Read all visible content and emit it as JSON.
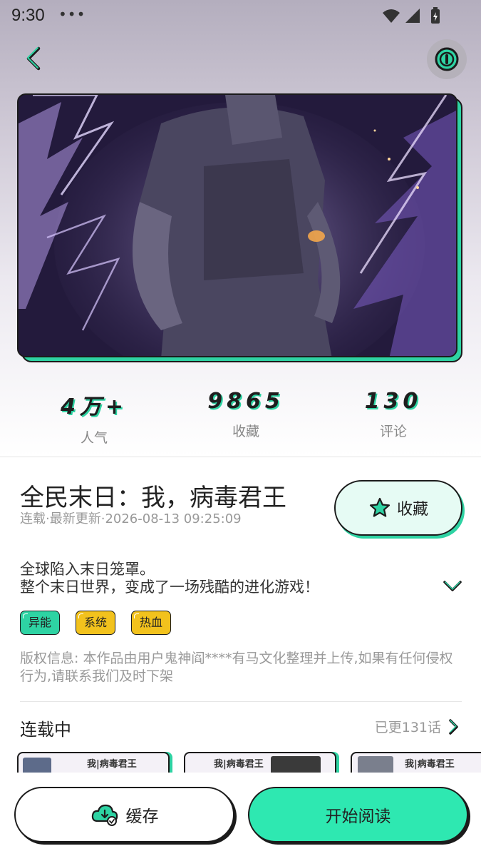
{
  "status_bar": {
    "time": "9:30",
    "dots": "•••"
  },
  "stats": [
    {
      "value": "4万+",
      "label": "人气"
    },
    {
      "value": "9865",
      "label": "收藏"
    },
    {
      "value": "130",
      "label": "评论"
    }
  ],
  "comic": {
    "title": "全民末日：我，病毒君王",
    "update": "连载·最新更新·2026-08-13 09:25:09",
    "description_line1": "全球陷入末日笼罩。",
    "description_line2": "整个末日世界，变成了一场残酷的进化游戏！",
    "tags": [
      "异能",
      "系统",
      "热血"
    ],
    "copyright": "版权信息: 本作品由用户鬼神阎****有马文化整理并上传,如果有任何侵权行为,请联系我们及时下架"
  },
  "favorite_button": {
    "label": "收藏"
  },
  "serial": {
    "title": "连载中",
    "count": "已更131话",
    "thumb_titles": [
      "我|病毒君王",
      "我|病毒君王",
      "我|病毒君王"
    ]
  },
  "actions": {
    "cache_label": "缓存",
    "read_label": "开始阅读"
  },
  "colors": {
    "accent": "#2ed3a3",
    "tag_yellow": "#f2c21d",
    "read_button": "#2ee8b1"
  }
}
